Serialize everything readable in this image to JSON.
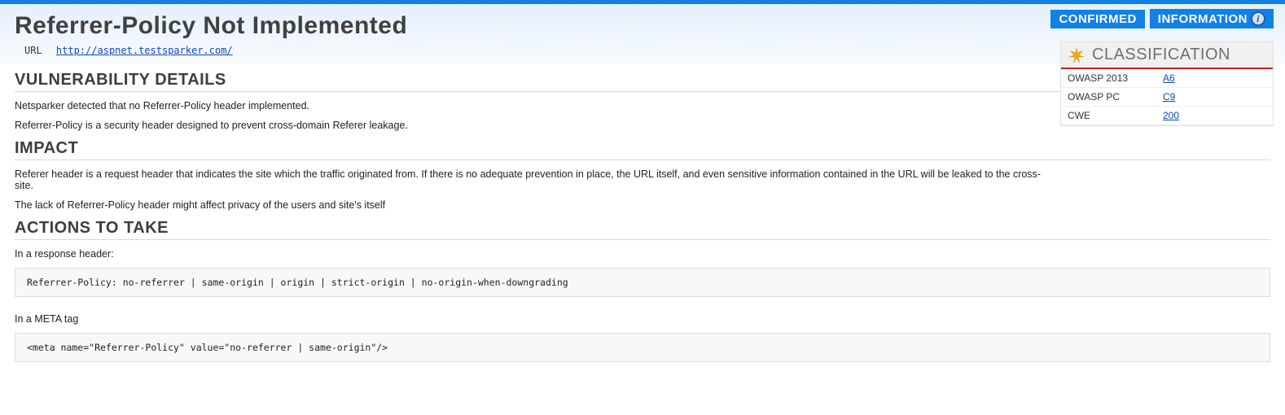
{
  "header": {
    "title": "Referrer-Policy Not Implemented",
    "url_label": "URL",
    "url": "http://aspnet.testsparker.com/"
  },
  "badges": {
    "confirmed": "CONFIRMED",
    "information": "INFORMATION"
  },
  "classification": {
    "title": "CLASSIFICATION",
    "rows": [
      {
        "key": "OWASP 2013",
        "val": "A6"
      },
      {
        "key": "OWASP PC",
        "val": "C9"
      },
      {
        "key": "CWE",
        "val": "200"
      }
    ]
  },
  "sections": {
    "vuln_details": {
      "heading": "VULNERABILITY DETAILS",
      "p1": "Netsparker detected that no Referrer-Policy header implemented.",
      "p2": "Referrer-Policy is a security header designed to prevent cross-domain Referer leakage."
    },
    "impact": {
      "heading": "IMPACT",
      "p1": "Referer header is a request header that indicates the site which the traffic originated from. If there is no adequate prevention in place, the  URL itself, and even sensitive information contained in the URL will be leaked to the cross-site.",
      "p2": "The lack of Referrer-Policy header might affect privacy of the users and site's itself"
    },
    "actions": {
      "heading": "ACTIONS TO TAKE",
      "lead1": "In a response header:",
      "code1": "Referrer-Policy: no-referrer | same-origin | origin | strict-origin | no-origin-when-downgrading",
      "lead2": "In a META tag",
      "code2": "<meta name=\"Referrer-Policy\" value=\"no-referrer | same-origin\"/>"
    }
  }
}
